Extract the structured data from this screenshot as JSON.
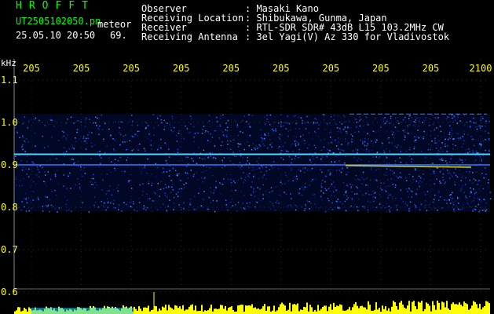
{
  "header": {
    "brand": "HROFFT",
    "filename": "UT2505102050.pn",
    "mode": "meteor",
    "datetime": "25.05.10 20:50",
    "count": "69.",
    "info_rows": [
      {
        "label": "Observer",
        "value": ": Masaki Kano"
      },
      {
        "label": "Receiving Location",
        "value": ": Shibukawa, Gunma, Japan"
      },
      {
        "label": "Receiver",
        "value": ": RTL-SDR SDR# 43dB L15 103.2MHz CW"
      },
      {
        "label": "Receiving Antenna",
        "value": ": 3el Yagi(V) Az 330 for Vladivostok"
      }
    ]
  },
  "colors": {
    "text": "#ffffff",
    "accent_green": "#00ff00",
    "axis_yellow": "#ffff00",
    "background": "#000000",
    "carrier_line": "#4fd8ff"
  },
  "chart_data": {
    "type": "heatmap",
    "title": "",
    "ylabel": "kHz",
    "xlabel": "",
    "x_tick_labels": [
      "205",
      "205",
      "205",
      "205",
      "205",
      "205",
      "205",
      "205",
      "205",
      "2100"
    ],
    "y_ticks": [
      {
        "value": 1.1,
        "label": "1.1"
      },
      {
        "value": 1.0,
        "label": "1.0"
      },
      {
        "value": 0.9,
        "label": "0.9"
      },
      {
        "value": 0.8,
        "label": "0.8"
      },
      {
        "value": 0.7,
        "label": "0.7"
      },
      {
        "value": 0.6,
        "label": "0.6"
      }
    ],
    "ylim": [
      0.6,
      1.15
    ],
    "noise_band_khz": [
      0.79,
      1.02
    ],
    "carrier_lines_khz": [
      0.925,
      0.9
    ],
    "grid": "dotted"
  }
}
